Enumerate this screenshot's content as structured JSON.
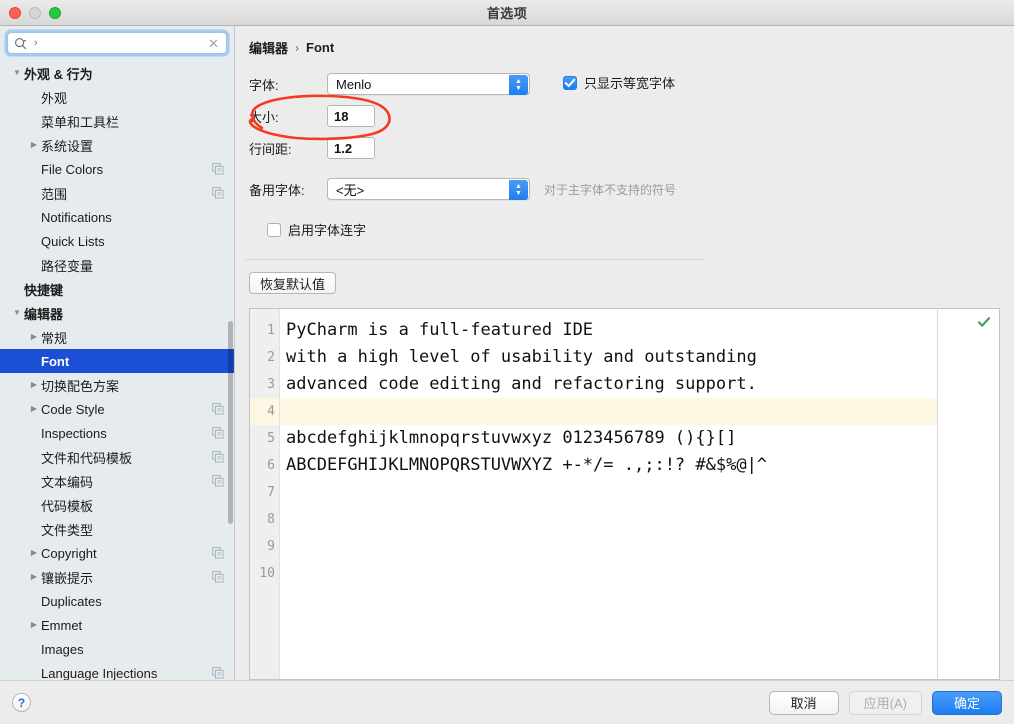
{
  "window": {
    "title": "首选项",
    "traffic_lights": [
      "close",
      "minimize",
      "zoom"
    ]
  },
  "search": {
    "value": "",
    "placeholder": "",
    "icon": "search-icon",
    "caret_glyph": "›",
    "clear_glyph": "✕"
  },
  "sidebar": {
    "items": [
      {
        "label": "外观 & 行为",
        "level": 0,
        "twisty": "▼",
        "bold": true,
        "selected": false,
        "copy": false
      },
      {
        "label": "外观",
        "level": 1,
        "twisty": "",
        "bold": false,
        "selected": false,
        "copy": false
      },
      {
        "label": "菜单和工具栏",
        "level": 1,
        "twisty": "",
        "bold": false,
        "selected": false,
        "copy": false
      },
      {
        "label": "系统设置",
        "level": 1,
        "twisty": "▶",
        "bold": false,
        "selected": false,
        "copy": false
      },
      {
        "label": "File Colors",
        "level": 1,
        "twisty": "",
        "bold": false,
        "selected": false,
        "copy": true
      },
      {
        "label": "范围",
        "level": 1,
        "twisty": "",
        "bold": false,
        "selected": false,
        "copy": true
      },
      {
        "label": "Notifications",
        "level": 1,
        "twisty": "",
        "bold": false,
        "selected": false,
        "copy": false
      },
      {
        "label": "Quick Lists",
        "level": 1,
        "twisty": "",
        "bold": false,
        "selected": false,
        "copy": false
      },
      {
        "label": "路径变量",
        "level": 1,
        "twisty": "",
        "bold": false,
        "selected": false,
        "copy": false
      },
      {
        "label": "快捷键",
        "level": 0,
        "twisty": "",
        "bold": true,
        "selected": false,
        "copy": false
      },
      {
        "label": "编辑器",
        "level": 0,
        "twisty": "▼",
        "bold": true,
        "selected": false,
        "copy": false
      },
      {
        "label": "常规",
        "level": 1,
        "twisty": "▶",
        "bold": false,
        "selected": false,
        "copy": false
      },
      {
        "label": "Font",
        "level": 1,
        "twisty": "",
        "bold": true,
        "selected": true,
        "copy": false
      },
      {
        "label": "切换配色方案",
        "level": 1,
        "twisty": "▶",
        "bold": false,
        "selected": false,
        "copy": false
      },
      {
        "label": "Code Style",
        "level": 1,
        "twisty": "▶",
        "bold": false,
        "selected": false,
        "copy": true
      },
      {
        "label": "Inspections",
        "level": 1,
        "twisty": "",
        "bold": false,
        "selected": false,
        "copy": true
      },
      {
        "label": "文件和代码模板",
        "level": 1,
        "twisty": "",
        "bold": false,
        "selected": false,
        "copy": true
      },
      {
        "label": "文本编码",
        "level": 1,
        "twisty": "",
        "bold": false,
        "selected": false,
        "copy": true
      },
      {
        "label": "代码模板",
        "level": 1,
        "twisty": "",
        "bold": false,
        "selected": false,
        "copy": false
      },
      {
        "label": "文件类型",
        "level": 1,
        "twisty": "",
        "bold": false,
        "selected": false,
        "copy": false
      },
      {
        "label": "Copyright",
        "level": 1,
        "twisty": "▶",
        "bold": false,
        "selected": false,
        "copy": true
      },
      {
        "label": "镶嵌提示",
        "level": 1,
        "twisty": "▶",
        "bold": false,
        "selected": false,
        "copy": true
      },
      {
        "label": "Duplicates",
        "level": 1,
        "twisty": "",
        "bold": false,
        "selected": false,
        "copy": false
      },
      {
        "label": "Emmet",
        "level": 1,
        "twisty": "▶",
        "bold": false,
        "selected": false,
        "copy": false
      },
      {
        "label": "Images",
        "level": 1,
        "twisty": "",
        "bold": false,
        "selected": false,
        "copy": false
      },
      {
        "label": "Language Injections",
        "level": 1,
        "twisty": "",
        "bold": false,
        "selected": false,
        "copy": true
      }
    ]
  },
  "breadcrumb": {
    "parent": "编辑器",
    "separator": "›",
    "current": "Font"
  },
  "form": {
    "font_label": "字体:",
    "font_value": "Menlo",
    "monospace_checkbox": {
      "label": "只显示等宽字体",
      "checked": true
    },
    "size_label": "大小:",
    "size_value": "18",
    "line_height_label": "行间距:",
    "line_height_value": "1.2",
    "fallback_label": "备用字体:",
    "fallback_value": "<无>",
    "fallback_hint": "对于主字体不支持的符号",
    "ligatures_checkbox": {
      "label": "启用字体连字",
      "checked": false
    },
    "restore_defaults_button": "恢复默认值"
  },
  "preview": {
    "lines": [
      {
        "n": "1",
        "text": "PyCharm is a full-featured IDE",
        "caret": false
      },
      {
        "n": "2",
        "text": "with a high level of usability and outstanding",
        "caret": false
      },
      {
        "n": "3",
        "text": "advanced code editing and refactoring support.",
        "caret": false
      },
      {
        "n": "4",
        "text": "",
        "caret": true
      },
      {
        "n": "5",
        "text": "abcdefghijklmnopqrstuvwxyz 0123456789 (){}[]",
        "caret": false
      },
      {
        "n": "6",
        "text": "ABCDEFGHIJKLMNOPQRSTUVWXYZ +-*/= .,;:!? #&$%@|^",
        "caret": false
      },
      {
        "n": "7",
        "text": "",
        "caret": false
      },
      {
        "n": "8",
        "text": "",
        "caret": false
      },
      {
        "n": "9",
        "text": "",
        "caret": false
      },
      {
        "n": "10",
        "text": "",
        "caret": false
      }
    ],
    "status_icon": "green-check-icon"
  },
  "footer": {
    "help_label": "?",
    "cancel_label": "取消",
    "apply_label": "应用(A)",
    "ok_label": "确定"
  },
  "annotation": {
    "shape": "red-ellipse-highlight",
    "color": "#f63a20",
    "targets": "大小: 18"
  },
  "colors": {
    "selection_blue": "#1a4fd6",
    "accent_blue": "#1c7ef0",
    "sidebar_bg": "#e6ebee",
    "panel_bg": "#ececec",
    "caret_line": "#fdf8e3",
    "annotation_red": "#f63a20",
    "status_green": "#4e9a5f"
  }
}
